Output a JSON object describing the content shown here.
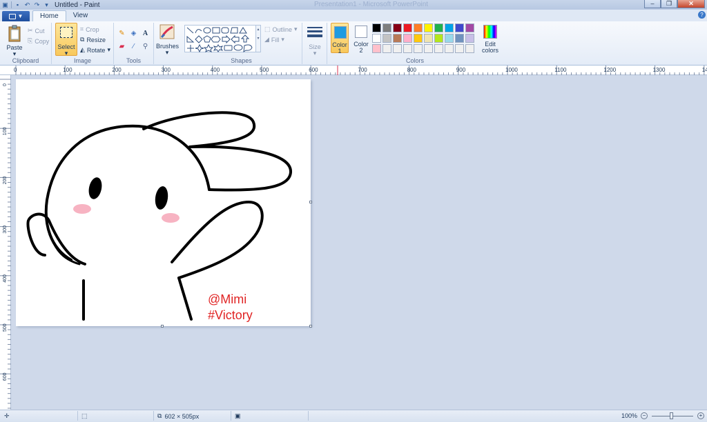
{
  "window": {
    "title": "Untitled - Paint",
    "center_title": "Presentation1 - Microsoft PowerPoint",
    "controls": [
      "–",
      "❐",
      "✕"
    ]
  },
  "tabs": [
    "Home",
    "View"
  ],
  "ribbon": {
    "clipboard": {
      "label": "Clipboard",
      "paste": "Paste",
      "cut": "Cut",
      "copy": "Copy"
    },
    "image": {
      "label": "Image",
      "select": "Select",
      "crop": "Crop",
      "resize": "Resize",
      "rotate": "Rotate"
    },
    "tools": {
      "label": "Tools",
      "text_tool": "A"
    },
    "brushes": {
      "label": "Brushes"
    },
    "shapes": {
      "label": "Shapes",
      "outline": "Outline",
      "fill": "Fill"
    },
    "size": {
      "label": "Size"
    },
    "colors": {
      "label": "Colors",
      "color1": "Color 1",
      "color2": "Color 2",
      "edit": "Edit colors",
      "color1_value": "#1f9be0",
      "color2_value": "#ffffff",
      "palette": [
        "#000000",
        "#7f7f7f",
        "#880015",
        "#ed1c24",
        "#ff7f27",
        "#fff200",
        "#22b14c",
        "#00a2e8",
        "#3f48cc",
        "#a349a4",
        "#ffffff",
        "#c3c3c3",
        "#b97a57",
        "#ffaec9",
        "#ffc90e",
        "#efe4b0",
        "#b5e61d",
        "#99d9ea",
        "#7092be",
        "#c8bfe7",
        "#ffc0cb",
        "#f0f0f0",
        "#f0f0f0",
        "#f0f0f0",
        "#f0f0f0",
        "#f0f0f0",
        "#f0f0f0",
        "#f0f0f0",
        "#f0f0f0",
        "#f0f0f0"
      ]
    }
  },
  "ruler": {
    "h_ticks": [
      "0",
      "100",
      "200",
      "300",
      "400",
      "500",
      "600",
      "700",
      "800",
      "900",
      "1000",
      "1100",
      "1200",
      "1300",
      "14"
    ],
    "v_ticks": [
      "0",
      "100",
      "200",
      "300",
      "400",
      "500",
      "600"
    ]
  },
  "canvas": {
    "watermark_line1": "@Mimi",
    "watermark_line2": "#Victory"
  },
  "status": {
    "image_size": "602 × 505px",
    "zoom": "100%"
  }
}
